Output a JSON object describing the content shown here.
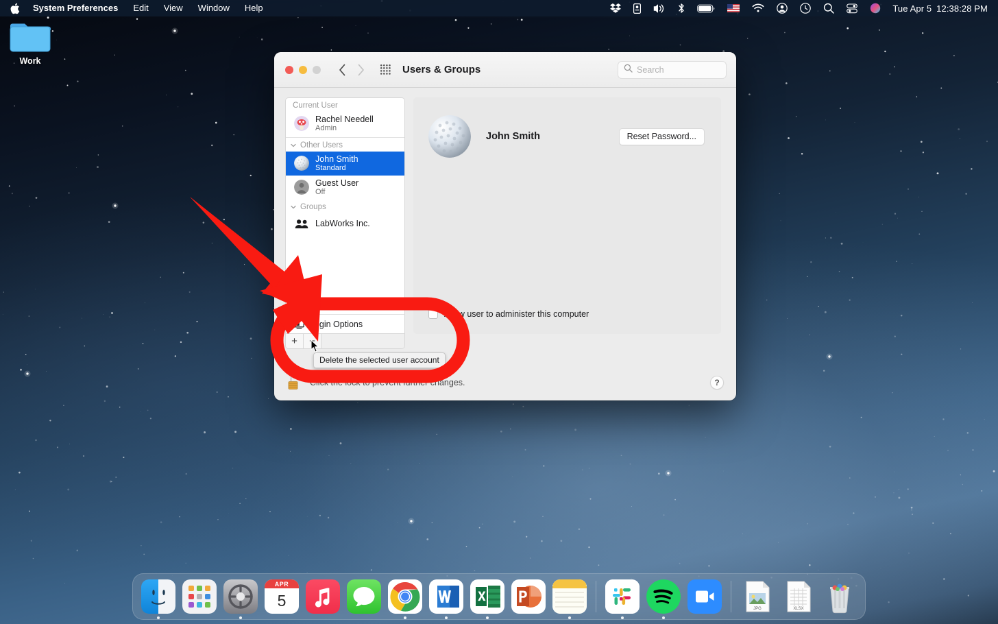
{
  "menubar": {
    "apple_icon": "apple-logo-icon",
    "items": [
      {
        "label": "System Preferences",
        "bold": true
      },
      {
        "label": "Edit",
        "bold": false
      },
      {
        "label": "View",
        "bold": false
      },
      {
        "label": "Window",
        "bold": false
      },
      {
        "label": "Help",
        "bold": false
      }
    ],
    "status_icons": [
      "dropbox-icon",
      "backup-icon",
      "volume-icon",
      "bluetooth-icon",
      "battery-icon",
      "us-flag-input-icon",
      "wifi-icon",
      "account-icon",
      "time-machine-icon",
      "spotlight-search-icon",
      "control-center-icon",
      "siri-icon"
    ],
    "date": "Tue Apr 5",
    "time": "12:38:28 PM"
  },
  "desktop": {
    "folder": {
      "label": "Work",
      "icon": "folder-icon"
    }
  },
  "window": {
    "title": "Users & Groups",
    "traffic_lights": [
      "close-button",
      "minimize-button",
      "zoom-button"
    ],
    "nav": {
      "back": "back-chevron-icon",
      "forward": "forward-chevron-icon",
      "grid": "show-all-grid-icon"
    },
    "search": {
      "placeholder": "Search",
      "icon": "search-icon",
      "value": ""
    }
  },
  "sidebar": {
    "groups": [
      {
        "header": "Current User",
        "has_disclosure": false,
        "rows": [
          {
            "name": "Rachel Needell",
            "sub": "Admin",
            "avatar": "mushroom-avatar",
            "selected": false
          }
        ]
      },
      {
        "header": "Other Users",
        "has_disclosure": true,
        "rows": [
          {
            "name": "John Smith",
            "sub": "Standard",
            "avatar": "golfball-avatar",
            "selected": true
          },
          {
            "name": "Guest User",
            "sub": "Off",
            "avatar": "person-avatar",
            "selected": false
          }
        ]
      },
      {
        "header": "Groups",
        "has_disclosure": true,
        "rows": [
          {
            "name": "LabWorks Inc.",
            "sub": "",
            "avatar": "group-people-icon",
            "selected": false
          }
        ]
      }
    ],
    "login_options": {
      "label": "Login Options",
      "icon": "login-options-icon"
    },
    "add_button": "+",
    "remove_button": "−"
  },
  "detail": {
    "avatar": "golfball-avatar",
    "user_name": "John Smith",
    "reset_password_label": "Reset Password...",
    "admin_checkbox": {
      "label": "Allow user to administer this computer",
      "checked": false
    }
  },
  "footer": {
    "lock_icon": "unlocked-padlock-icon",
    "lock_text": "Click the lock to prevent further changes.",
    "help_label": "?"
  },
  "tooltip": {
    "text": "Delete the selected user account"
  },
  "annotation": {
    "color": "#F91B12",
    "shapes": [
      "arrow-pointing-to-remove-button",
      "oval-highlight-ring"
    ]
  },
  "dock": {
    "items": [
      {
        "name": "Finder",
        "icon": "finder-icon",
        "running": true
      },
      {
        "name": "Launchpad",
        "icon": "launchpad-icon",
        "running": false
      },
      {
        "name": "System Preferences",
        "icon": "system-preferences-icon",
        "running": true
      },
      {
        "name": "Calendar",
        "icon": "calendar-icon",
        "running": false,
        "month": "APR",
        "day": "5"
      },
      {
        "name": "Music",
        "icon": "music-icon",
        "running": false
      },
      {
        "name": "Messages",
        "icon": "messages-icon",
        "running": false
      },
      {
        "name": "Google Chrome",
        "icon": "chrome-icon",
        "running": true
      },
      {
        "name": "Microsoft Word",
        "icon": "word-icon",
        "running": true
      },
      {
        "name": "Microsoft Excel",
        "icon": "excel-icon",
        "running": true
      },
      {
        "name": "Microsoft PowerPoint",
        "icon": "powerpoint-icon",
        "running": false
      },
      {
        "name": "Notes",
        "icon": "notes-icon",
        "running": true
      },
      {
        "separator": true
      },
      {
        "name": "Slack",
        "icon": "slack-icon",
        "running": true
      },
      {
        "name": "Spotify",
        "icon": "spotify-icon",
        "running": true
      },
      {
        "name": "Zoom",
        "icon": "zoom-icon",
        "running": false
      },
      {
        "separator": true
      },
      {
        "name": "JPG file",
        "icon": "jpg-file-icon",
        "label": "JPG",
        "running": false
      },
      {
        "name": "XLSX file",
        "icon": "xlsx-file-icon",
        "label": "XLSX",
        "running": false
      },
      {
        "name": "Trash",
        "icon": "trash-icon",
        "running": false
      }
    ]
  }
}
